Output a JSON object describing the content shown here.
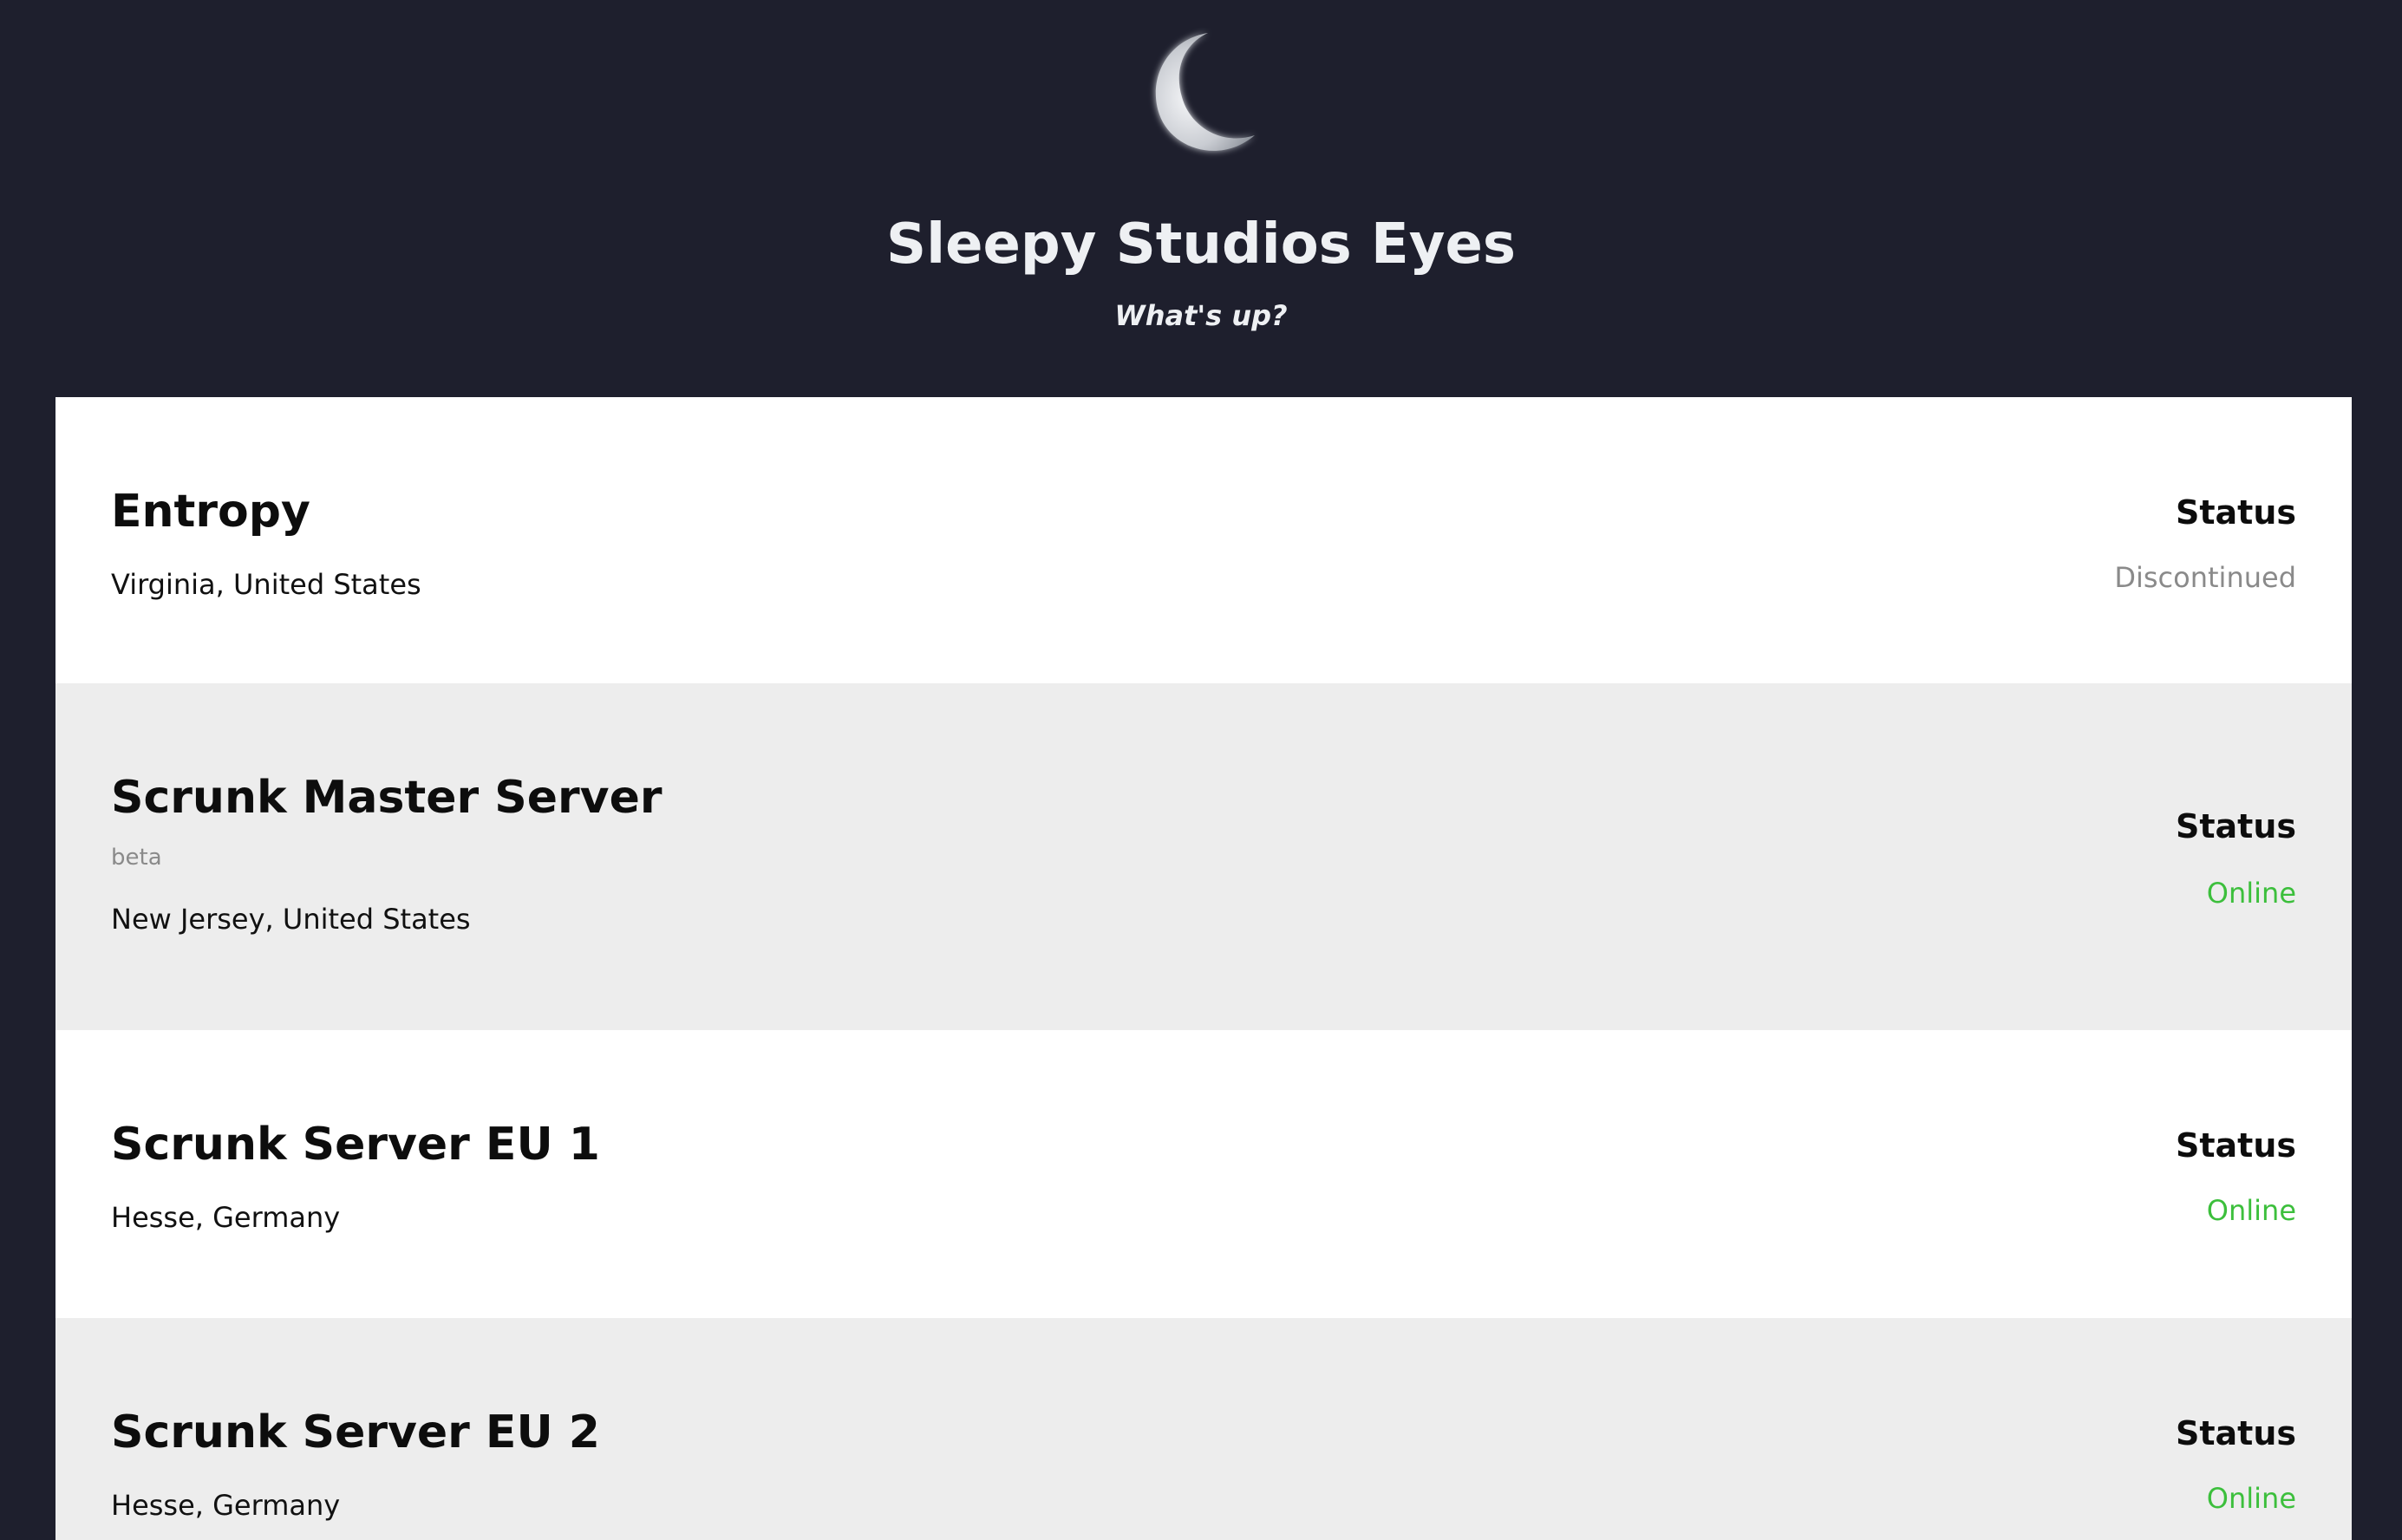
{
  "header": {
    "title": "Sleepy Studios Eyes",
    "tagline": "What's up?",
    "logo_icon": "crescent-moon-icon"
  },
  "colors": {
    "page_background": "#1e1f2d",
    "online": "#3cbf3c",
    "discontinued": "#8a8a8a"
  },
  "servers": [
    {
      "name": "Entropy",
      "tag": "",
      "location": "Virginia, United States",
      "status_label": "Status",
      "status": "Discontinued",
      "status_color": "#8a8a8a"
    },
    {
      "name": "Scrunk Master Server",
      "tag": "beta",
      "location": "New Jersey, United States",
      "status_label": "Status",
      "status": "Online",
      "status_color": "#3cbf3c"
    },
    {
      "name": "Scrunk Server EU 1",
      "tag": "",
      "location": "Hesse, Germany",
      "status_label": "Status",
      "status": "Online",
      "status_color": "#3cbf3c"
    },
    {
      "name": "Scrunk Server EU 2",
      "tag": "",
      "location": "Hesse, Germany",
      "status_label": "Status",
      "status": "Online",
      "status_color": "#3cbf3c"
    }
  ]
}
